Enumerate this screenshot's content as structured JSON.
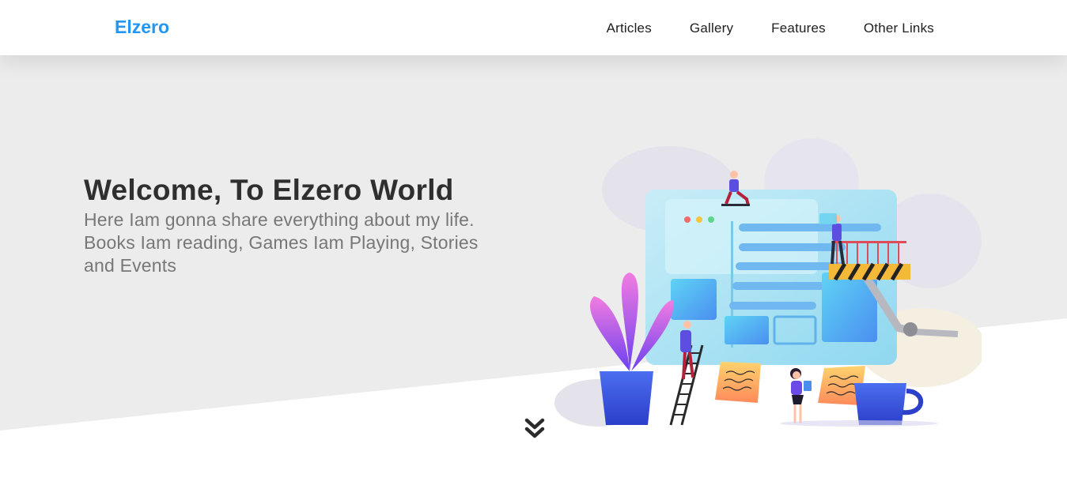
{
  "header": {
    "logo": "Elzero",
    "nav": [
      "Articles",
      "Gallery",
      "Features",
      "Other Links"
    ]
  },
  "hero": {
    "title": "Welcome, To Elzero World",
    "description": "Here Iam gonna share everything about my life. Books Iam reading, Games Iam Playing, Stories and Events"
  },
  "icons": {
    "scroll_down": "double-chevron-down-icon"
  },
  "colors": {
    "brand": "#2196f3",
    "hero_background": "#ececec",
    "text_dark": "#2f2f2f",
    "text_muted": "#777777"
  }
}
